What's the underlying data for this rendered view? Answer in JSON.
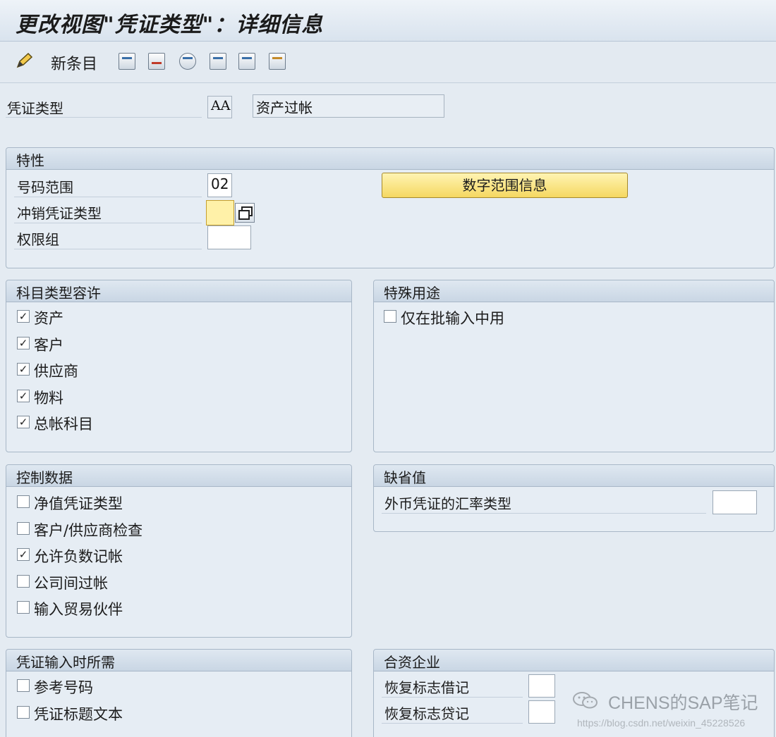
{
  "window": {
    "title": "更改视图\"凭证类型\"：详细信息"
  },
  "toolbar": {
    "new_entries_label": "新条目",
    "icons": [
      "display-change-icon",
      "copy-icon",
      "delete-icon",
      "undo-icon",
      "previous-entry-icon",
      "next-entry-icon",
      "transport-icon"
    ]
  },
  "header": {
    "doc_type_label": "凭证类型",
    "doc_type_value": "AA",
    "doc_type_desc": "资产过帐"
  },
  "properties": {
    "title": "特性",
    "number_range_label": "号码范围",
    "number_range_value": "02",
    "reverse_doc_type_label": "冲销凭证类型",
    "reverse_doc_type_value": "",
    "auth_group_label": "权限组",
    "auth_group_value": "",
    "number_range_info_button": "数字范围信息"
  },
  "account_types": {
    "title": "科目类型容许",
    "items": [
      {
        "label": "资产",
        "checked": true
      },
      {
        "label": "客户",
        "checked": true
      },
      {
        "label": "供应商",
        "checked": true
      },
      {
        "label": "物料",
        "checked": true
      },
      {
        "label": "总帐科目",
        "checked": true
      }
    ]
  },
  "special_usage": {
    "title": "特殊用途",
    "items": [
      {
        "label": "仅在批输入中用",
        "checked": false
      }
    ]
  },
  "control_data": {
    "title": "控制数据",
    "items": [
      {
        "label": "净值凭证类型",
        "checked": false
      },
      {
        "label": "客户/供应商检查",
        "checked": false
      },
      {
        "label": "允许负数记帐",
        "checked": true
      },
      {
        "label": "公司间过帐",
        "checked": false
      },
      {
        "label": "输入贸易伙伴",
        "checked": false
      }
    ]
  },
  "defaults": {
    "title": "缺省值",
    "fx_rate_type_label": "外币凭证的汇率类型",
    "fx_rate_type_value": ""
  },
  "required_entry": {
    "title": "凭证输入时所需",
    "items": [
      {
        "label": "参考号码",
        "checked": false
      },
      {
        "label": "凭证标题文本",
        "checked": false
      }
    ]
  },
  "joint_venture": {
    "title": "合资企业",
    "debit_recovery_label": "恢复标志借记",
    "debit_recovery_value": "",
    "credit_recovery_label": "恢复标志贷记",
    "credit_recovery_value": ""
  },
  "watermark": {
    "text": "CHENS的SAP笔记",
    "url": "https://blog.csdn.net/weixin_45228526"
  },
  "check_mark": "✓"
}
